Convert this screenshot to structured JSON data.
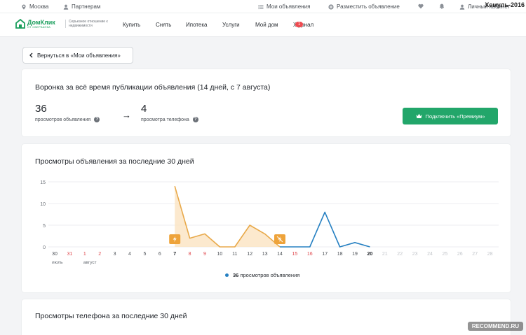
{
  "topbar": {
    "city": "Москва",
    "partners": "Партнерам",
    "my_ads": "Мои объявления",
    "place_ad": "Разместить объявление",
    "account": "Личный кабинет",
    "watermark_user": "Хемуль-2016"
  },
  "navbar": {
    "logo_name": "ДомКлик",
    "logo_sub": "ОТ СБЕРБАНКА",
    "tagline": "Серьезное отношение к недвижимости",
    "links": [
      "Купить",
      "Снять",
      "Ипотека",
      "Услуги",
      "Мой дом",
      "Журнал"
    ],
    "journal_badge": "1"
  },
  "back_button": "Вернуться в «Мои объявления»",
  "funnel": {
    "title": "Воронка за всё время публикации объявления (14 дней, с 7 августа)",
    "views_count": "36",
    "views_label": "просмотров объявления",
    "phone_count": "4",
    "phone_label": "просмотра телефона",
    "premium_button": "Подключить «Премиум»"
  },
  "views_chart": {
    "title": "Просмотры объявления за последние 30 дней",
    "legend_count": "36",
    "legend_text": "просмотров объявления"
  },
  "phone_chart": {
    "title": "Просмотры телефона за последние 30 дней"
  },
  "watermark": "RECOMMEND.RU",
  "colors": {
    "brand_green": "#22a66a",
    "promo_line": "#e8a94a",
    "promo_fill": "#fbe3c2",
    "views_line": "#2680c2",
    "weekend_red": "#e0474c",
    "badge_red": "#ee4b51"
  },
  "chart_data": {
    "type": "line",
    "title": "Просмотры объявления за последние 30 дней",
    "categories": [
      "30",
      "31",
      "1",
      "2",
      "3",
      "4",
      "5",
      "6",
      "7",
      "8",
      "9",
      "10",
      "11",
      "12",
      "13",
      "14",
      "15",
      "16",
      "17",
      "18",
      "19",
      "20",
      "21",
      "22",
      "23",
      "24",
      "25",
      "26",
      "27",
      "28"
    ],
    "month_labels": [
      "июль",
      "август"
    ],
    "weekend_days": [
      "31",
      "1",
      "2",
      "8",
      "9",
      "15",
      "16"
    ],
    "future_days": [
      "21",
      "22",
      "23",
      "24",
      "25",
      "26",
      "27",
      "28"
    ],
    "ylim": [
      0,
      15
    ],
    "yticks": [
      "0",
      "5",
      "10",
      "15"
    ],
    "series": [
      {
        "name": "36 просмотров объявления",
        "color": "#e8a94a",
        "fill": "#fbe3c2",
        "x": [
          "7",
          "8",
          "9",
          "10",
          "11",
          "12",
          "13",
          "14"
        ],
        "values": [
          14,
          2,
          3,
          0,
          0,
          5,
          3,
          0
        ]
      },
      {
        "color": "#2680c2",
        "x": [
          "14",
          "15",
          "16",
          "17",
          "18",
          "19",
          "20"
        ],
        "values": [
          0,
          0,
          0,
          8,
          0,
          1,
          0
        ]
      }
    ],
    "promo_markers": [
      {
        "day": "7",
        "icon": "lightning-icon"
      },
      {
        "day": "14",
        "icon": "lightning-off-icon"
      }
    ],
    "grid": true
  }
}
